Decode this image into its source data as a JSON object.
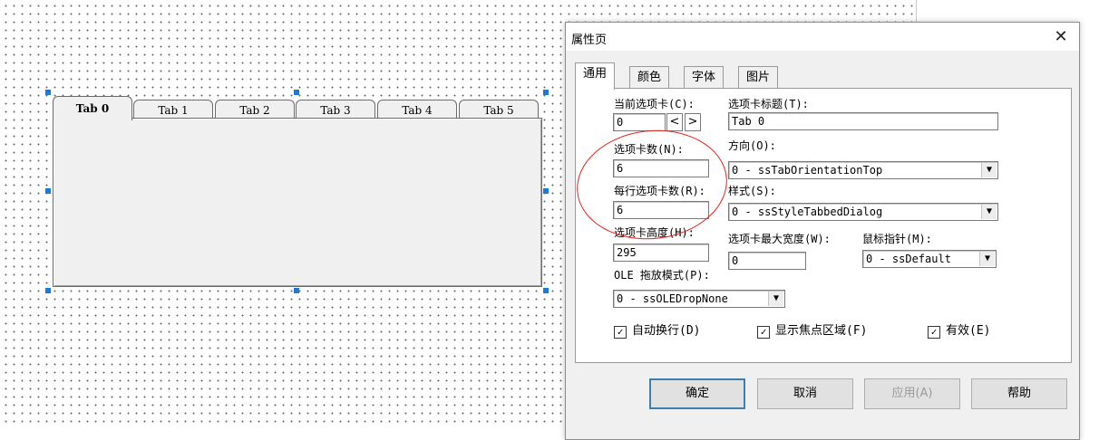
{
  "designer": {
    "sstab": {
      "tabs": [
        "Tab 0",
        "Tab 1",
        "Tab 2",
        "Tab 3",
        "Tab 4",
        "Tab 5"
      ],
      "active_index": 0
    }
  },
  "dialog": {
    "title": "属性页",
    "close_glyph": "✕",
    "tabs": [
      "通用",
      "颜色",
      "字体",
      "图片"
    ],
    "active_tab": "通用",
    "general": {
      "current_tab_label": "当前选项卡(C):",
      "current_tab_value": "0",
      "spin_prev": "<",
      "spin_next": ">",
      "tab_count_label": "选项卡数(N):",
      "tab_count_value": "6",
      "tabs_per_row_label": "每行选项卡数(R):",
      "tabs_per_row_value": "6",
      "tab_height_label": "选项卡高度(H):",
      "tab_height_value": "295",
      "ole_drop_label": "OLE 拖放模式(P):",
      "ole_drop_value": "0 - ssOLEDropNone",
      "tab_caption_label": "选项卡标题(T):",
      "tab_caption_value": "Tab 0",
      "orientation_label": "方向(O):",
      "orientation_value": "0 - ssTabOrientationTop",
      "style_label": "样式(S):",
      "style_value": "0 - ssStyleTabbedDialog",
      "max_width_label": "选项卡最大宽度(W):",
      "max_width_value": "0",
      "mouse_pointer_label": "鼠标指针(M):",
      "mouse_pointer_value": "0 - ssDefault",
      "word_wrap_label": "自动换行(D)",
      "word_wrap_checked": true,
      "show_focus_label": "显示焦点区域(F)",
      "show_focus_checked": true,
      "enabled_label": "有效(E)",
      "enabled_checked": true
    },
    "buttons": {
      "ok": "确定",
      "cancel": "取消",
      "apply": "应用(A)",
      "help": "帮助"
    }
  },
  "colors": {
    "selection_handle": "#1e78d6",
    "annotation": "#e0241b",
    "default_button_border": "#3c7fb1"
  }
}
